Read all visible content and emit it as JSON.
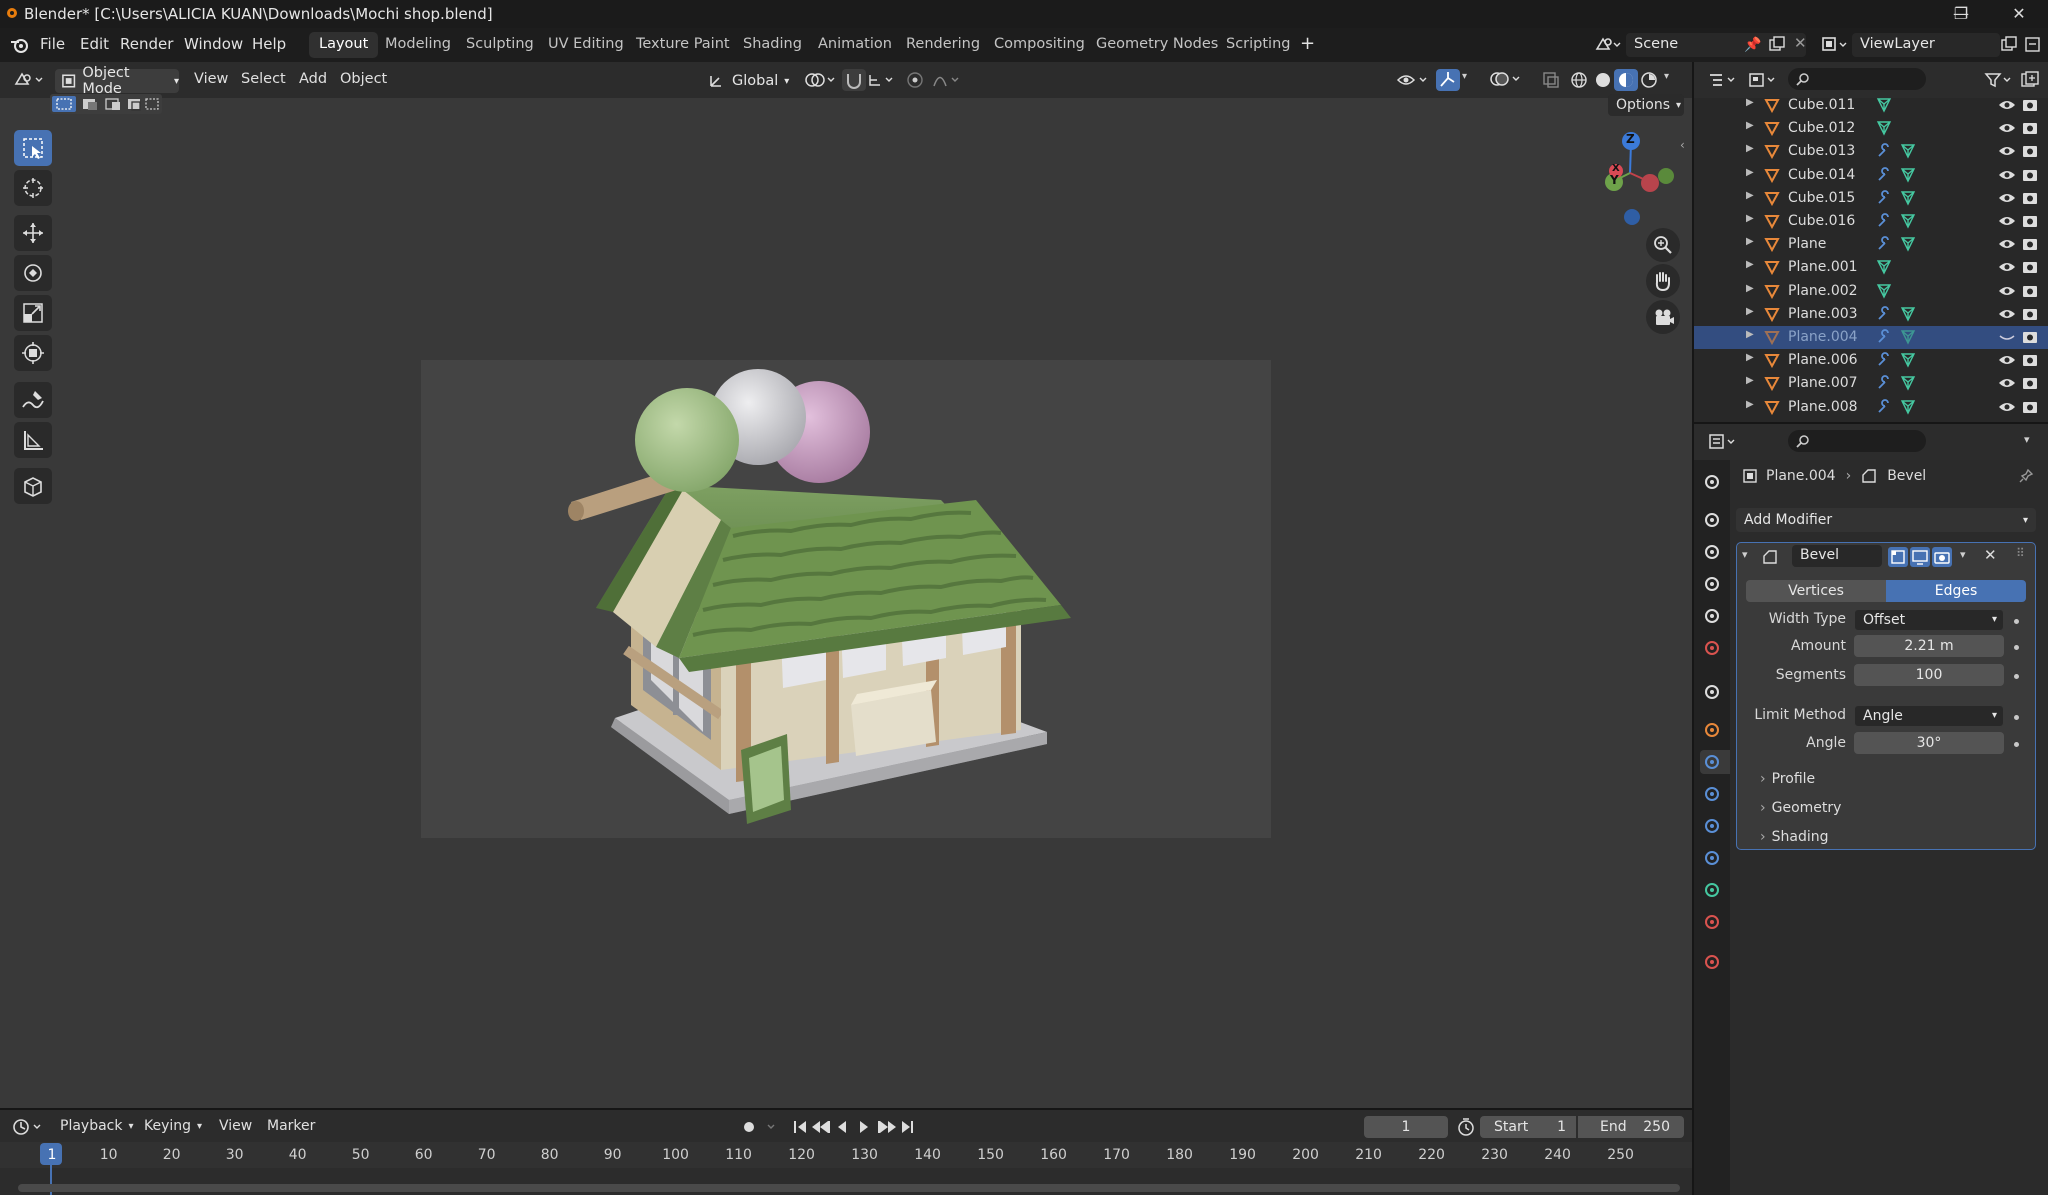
{
  "window": {
    "title": "Blender* [C:\\Users\\ALICIA KUAN\\Downloads\\Mochi shop.blend]"
  },
  "menu": [
    "File",
    "Edit",
    "Render",
    "Window",
    "Help"
  ],
  "workspaces": [
    "Layout",
    "Modeling",
    "Sculpting",
    "UV Editing",
    "Texture Paint",
    "Shading",
    "Animation",
    "Rendering",
    "Compositing",
    "Geometry Nodes",
    "Scripting"
  ],
  "active_workspace": "Layout",
  "scene": "Scene",
  "view_layer": "ViewLayer",
  "viewport": {
    "mode": "Object Mode",
    "menus": [
      "View",
      "Select",
      "Add",
      "Object"
    ],
    "transform_orientation": "Global",
    "options_label": "Options",
    "gizmo_axes": [
      "Z",
      "Y",
      "X"
    ]
  },
  "outliner": {
    "items": [
      {
        "name": "Cube.011",
        "modifier": false
      },
      {
        "name": "Cube.012",
        "modifier": false
      },
      {
        "name": "Cube.013",
        "modifier": true
      },
      {
        "name": "Cube.014",
        "modifier": true
      },
      {
        "name": "Cube.015",
        "modifier": true
      },
      {
        "name": "Cube.016",
        "modifier": true
      },
      {
        "name": "Plane",
        "modifier": true
      },
      {
        "name": "Plane.001",
        "modifier": false
      },
      {
        "name": "Plane.002",
        "modifier": false
      },
      {
        "name": "Plane.003",
        "modifier": true
      },
      {
        "name": "Plane.004",
        "modifier": true,
        "selected": true
      },
      {
        "name": "Plane.006",
        "modifier": true
      },
      {
        "name": "Plane.007",
        "modifier": true
      },
      {
        "name": "Plane.008",
        "modifier": true
      }
    ]
  },
  "properties": {
    "breadcrumb_object": "Plane.004",
    "breadcrumb_modifier": "Bevel",
    "add_modifier": "Add Modifier",
    "modifier_name": "Bevel",
    "affect_vertices": "Vertices",
    "affect_edges": "Edges",
    "width_type_label": "Width Type",
    "width_type_value": "Offset",
    "amount_label": "Amount",
    "amount_value": "2.21 m",
    "segments_label": "Segments",
    "segments_value": "100",
    "limit_method_label": "Limit Method",
    "limit_method_value": "Angle",
    "angle_label": "Angle",
    "angle_value": "30°",
    "subpanels": [
      "Profile",
      "Geometry",
      "Shading"
    ]
  },
  "timeline": {
    "menus": [
      "Playback",
      "Keying",
      "View",
      "Marker"
    ],
    "current_frame": "1",
    "start_label": "Start",
    "start_value": "1",
    "end_label": "End",
    "end_value": "250",
    "ruler": [
      "1",
      "10",
      "20",
      "30",
      "40",
      "50",
      "60",
      "70",
      "80",
      "90",
      "100",
      "110",
      "120",
      "130",
      "140",
      "150",
      "160",
      "170",
      "180",
      "190",
      "200",
      "210",
      "220",
      "230",
      "240",
      "250"
    ]
  },
  "colors": {
    "accent": "#4772b3",
    "selection": "#334d80",
    "roof_green": "#6b8f52",
    "mochi_green": "#a9c48f",
    "mochi_white": "#d6d6da",
    "mochi_pink": "#c99ac0",
    "wood": "#b99f7e"
  }
}
